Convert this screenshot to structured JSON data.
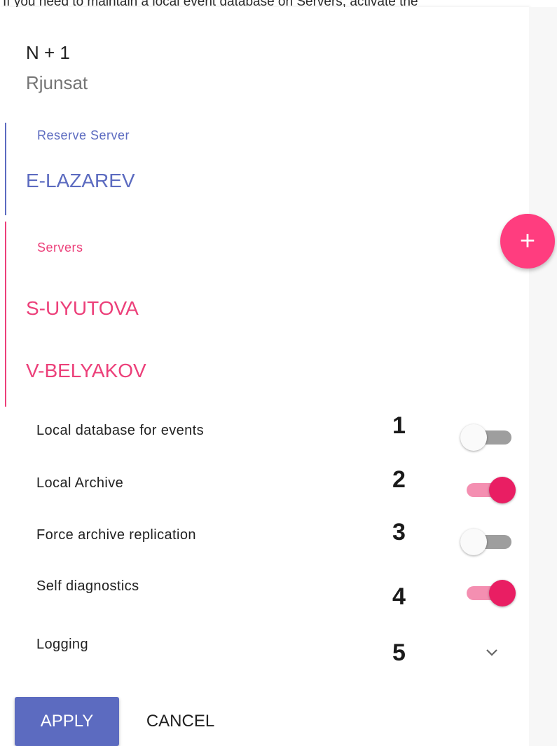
{
  "top_text": "If you need to maintain a local event database on Servers, activate the",
  "profile": {
    "title": "N + 1",
    "subtitle": "Rjunsat"
  },
  "reserve_group": {
    "label": "Reserve Server",
    "servers": [
      "E-LAZAREV"
    ]
  },
  "servers_group": {
    "label": "Servers",
    "servers": [
      "S-UYUTOVA",
      "V-BELYAKOV"
    ]
  },
  "add_button_glyph": "+",
  "options": [
    {
      "label": "Local database for events",
      "number": "1",
      "control": "toggle",
      "enabled": false
    },
    {
      "label": "Local Archive",
      "number": "2",
      "control": "toggle",
      "enabled": true
    },
    {
      "label": "Force archive replication",
      "number": "3",
      "control": "toggle",
      "enabled": false
    },
    {
      "label": "Self diagnostics",
      "number": "4",
      "control": "toggle",
      "enabled": true
    },
    {
      "label": "Logging",
      "number": "5",
      "control": "expand",
      "icon": "chevron-down-icon"
    }
  ],
  "actions": {
    "apply": "APPLY",
    "cancel": "CANCEL"
  },
  "colors": {
    "reserve_accent": "#5c6bc0",
    "servers_accent": "#ec407a",
    "fab": "#ff3d7f",
    "toggle_on": "#e91e63",
    "apply_button": "#5c6bc0"
  }
}
